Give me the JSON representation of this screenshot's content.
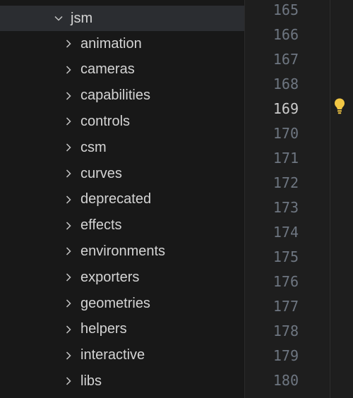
{
  "explorer": {
    "open_folder": {
      "label": "jsm"
    },
    "items": [
      {
        "label": "animation"
      },
      {
        "label": "cameras"
      },
      {
        "label": "capabilities"
      },
      {
        "label": "controls"
      },
      {
        "label": "csm"
      },
      {
        "label": "curves"
      },
      {
        "label": "deprecated"
      },
      {
        "label": "effects"
      },
      {
        "label": "environments"
      },
      {
        "label": "exporters"
      },
      {
        "label": "geometries"
      },
      {
        "label": "helpers"
      },
      {
        "label": "interactive"
      },
      {
        "label": "libs"
      }
    ]
  },
  "editor": {
    "line_numbers": [
      "165",
      "166",
      "167",
      "168",
      "169",
      "170",
      "171",
      "172",
      "173",
      "174",
      "175",
      "176",
      "177",
      "178",
      "179",
      "180"
    ],
    "active_line": "169",
    "icons": {
      "lightbulb": "lightbulb-icon",
      "chevron_right": "chevron-right-icon",
      "chevron_down": "chevron-down-icon"
    },
    "colors": {
      "lightbulb": "#f2c744",
      "line_number": "#6e7681",
      "active_line_number": "#cccccc"
    }
  }
}
